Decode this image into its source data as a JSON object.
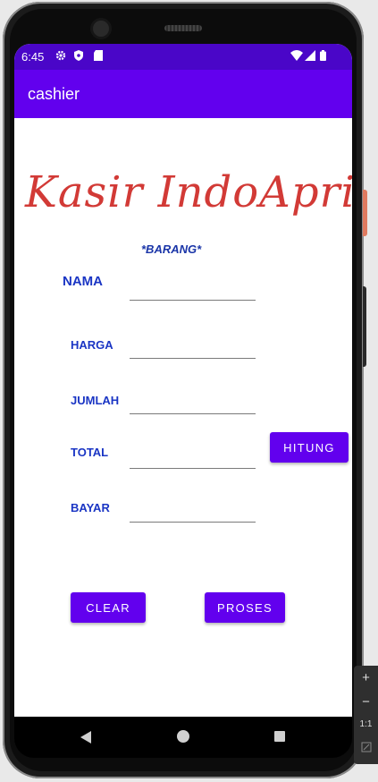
{
  "status_bar": {
    "time": "6:45",
    "icons": [
      "gear-icon",
      "shield-icon",
      "sd-card-icon",
      "wifi-icon",
      "signal-icon",
      "battery-icon"
    ]
  },
  "app_bar": {
    "title": "cashier"
  },
  "logo_text": "Kasir IndoApril",
  "section_title": "*BARANG*",
  "form": {
    "nama_label": "NAMA",
    "harga_label": "HARGA",
    "jumlah_label": "JUMLAH",
    "total_label": "TOTAL",
    "bayar_label": "BAYAR",
    "nama_value": "",
    "harga_value": "",
    "jumlah_value": "",
    "total_value": "",
    "bayar_value": ""
  },
  "buttons": {
    "hitung": "HITUNG",
    "clear": "CLEAR",
    "proses": "PROSES"
  },
  "zoom_panel": {
    "plus": "+",
    "minus": "−",
    "ratio": "1:1"
  },
  "colors": {
    "primary": "#6200ee",
    "status_bar": "#4a06c8",
    "label": "#1a35c4",
    "logo": "#d23a36"
  }
}
